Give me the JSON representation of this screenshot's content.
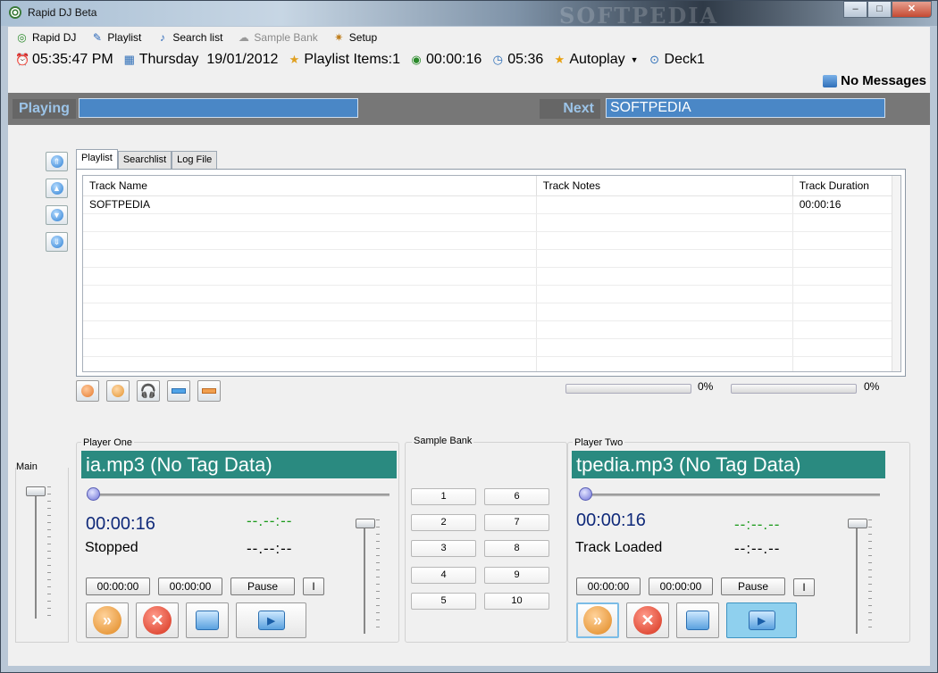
{
  "window": {
    "title": "Rapid DJ Beta",
    "watermark": "SOFTPEDIA"
  },
  "menu": [
    {
      "label": "Rapid DJ",
      "icon": "rapid-dj-icon",
      "enabled": true
    },
    {
      "label": "Playlist",
      "icon": "playlist-icon",
      "enabled": true
    },
    {
      "label": "Search list",
      "icon": "note-icon",
      "enabled": true
    },
    {
      "label": "Sample Bank",
      "icon": "sample-bank-icon",
      "enabled": false
    },
    {
      "label": "Setup",
      "icon": "setup-icon",
      "enabled": true
    }
  ],
  "status": {
    "clock": "05:35:47 PM",
    "day": "Thursday",
    "date": "19/01/2012",
    "playlist_items": "Playlist Items:1",
    "total_time": "00:00:16",
    "remaining": "05:36",
    "autoplay": "Autoplay",
    "deck": "Deck1"
  },
  "messages": "No Messages",
  "now": {
    "playing_label": "Playing",
    "playing_value": "",
    "next_label": "Next",
    "next_value": "SOFTPEDIA"
  },
  "tabs": [
    "Playlist",
    "Searchlist",
    "Log File"
  ],
  "grid": {
    "columns": [
      "Track Name",
      "Track Notes",
      "Track Duration"
    ],
    "rows": [
      [
        "SOFTPEDIA",
        "",
        "00:00:16"
      ]
    ]
  },
  "progress": [
    {
      "value": 0,
      "label": "0%"
    },
    {
      "value": 0,
      "label": "0%"
    }
  ],
  "main_label": "Main",
  "main_level": 0.98,
  "players": [
    {
      "label": "Player One",
      "title": "ia.mp3 (No Tag Data)",
      "time": "00:00:16",
      "state": "Stopped",
      "dash1": "--.--:--",
      "dash2": "--.--:--",
      "start": "00:00:00",
      "end": "00:00:00",
      "pause": "Pause",
      "cue": "I",
      "volume": 0.98
    },
    {
      "label": "Player Two",
      "title": "tpedia.mp3 (No Tag Data)",
      "time": "00:00:16",
      "state": "Track Loaded",
      "dash1": "--:--.--",
      "dash2": "--:--.--",
      "start": "00:00:00",
      "end": "00:00:00",
      "pause": "Pause",
      "cue": "I",
      "volume": 0.98
    }
  ],
  "sample_bank": {
    "label": "Sample Bank",
    "buttons": [
      "1",
      "2",
      "3",
      "4",
      "5",
      "6",
      "7",
      "8",
      "9",
      "10"
    ]
  }
}
